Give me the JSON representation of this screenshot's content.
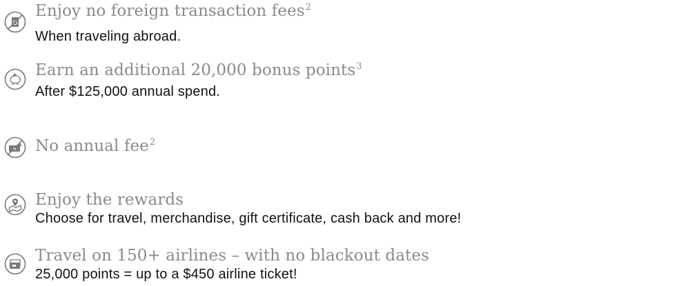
{
  "benefits": [
    {
      "icon": "no-currency-icon",
      "title": "Enjoy no foreign transaction fees",
      "footnote": "2",
      "subtitle": "When traveling abroad."
    },
    {
      "icon": "piggy-bank-icon",
      "title": "Earn an additional 20,000 bonus points",
      "footnote": "3",
      "subtitle": "After $125,000 annual spend."
    },
    {
      "icon": "no-annual-fee-icon",
      "title": "No annual fee",
      "footnote": "2",
      "subtitle": ""
    },
    {
      "icon": "map-pin-icon",
      "title": "Enjoy the rewards",
      "footnote": "",
      "subtitle": "Choose for travel, merchandise, gift certificate, cash back and more!"
    },
    {
      "icon": "airline-ticket-icon",
      "title": "Travel on 150+ airlines – with no blackout dates",
      "footnote": "",
      "subtitle": "25,000 points = up to a $450 airline ticket!"
    }
  ],
  "colors": {
    "icon_stroke": "#7a7a7a",
    "title": "#8a8a8a",
    "subtitle": "#111111"
  }
}
